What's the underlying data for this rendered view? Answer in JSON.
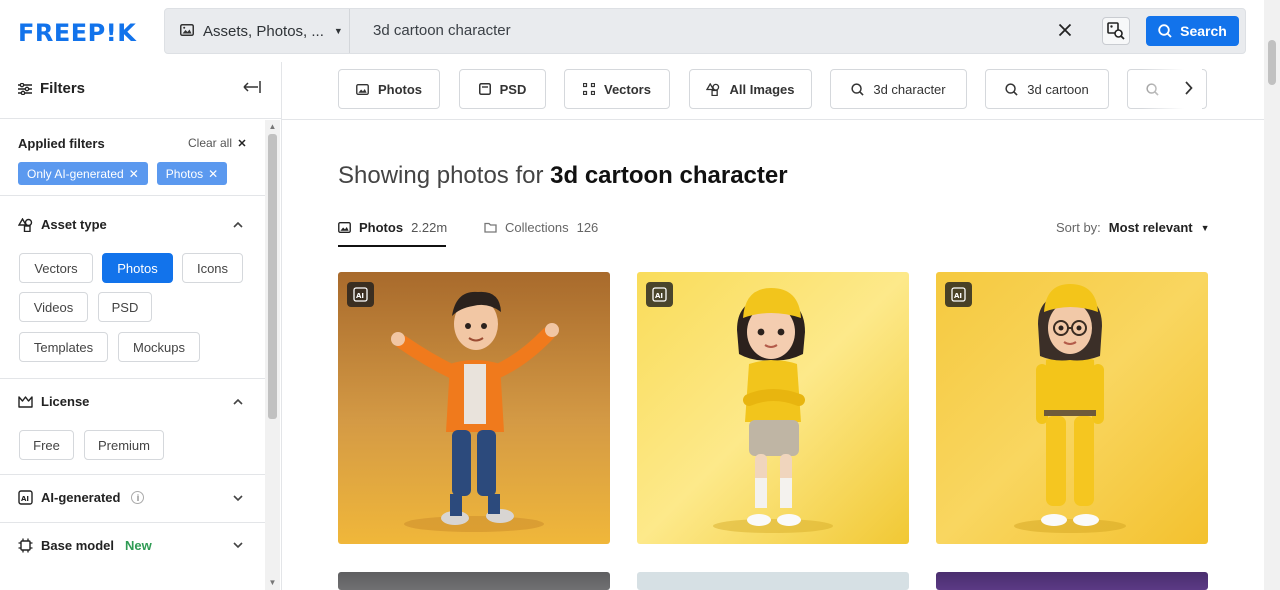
{
  "header": {
    "logo": "FREEP!K",
    "asset_selector": "Assets, Photos, ...",
    "search_value": "3d cartoon character",
    "search_button": "Search"
  },
  "sidebar": {
    "title": "Filters",
    "applied_filters_label": "Applied filters",
    "clear_all": "Clear all",
    "applied_chips": [
      "Only AI-generated",
      "Photos"
    ],
    "asset_type": {
      "title": "Asset type",
      "options": [
        "Vectors",
        "Photos",
        "Icons",
        "Videos",
        "PSD",
        "Templates",
        "Mockups"
      ],
      "selected": "Photos"
    },
    "license": {
      "title": "License",
      "options": [
        "Free",
        "Premium"
      ]
    },
    "ai_generated": {
      "title": "AI-generated"
    },
    "base_model": {
      "title": "Base model",
      "badge": "New"
    }
  },
  "filter_chips": [
    "Photos",
    "PSD",
    "Vectors",
    "All Images",
    "3d character",
    "3d cartoon"
  ],
  "results": {
    "title_prefix": "Showing photos for",
    "title_query": "3d cartoon character",
    "tabs": [
      {
        "label": "Photos",
        "count": "2.22m"
      },
      {
        "label": "Collections",
        "count": "126"
      }
    ],
    "sort_label": "Sort by:",
    "sort_value": "Most relevant"
  },
  "colors": {
    "brand_blue": "#1273eb",
    "chip_blue": "#5b99ef",
    "new_green": "#2f9b54"
  }
}
